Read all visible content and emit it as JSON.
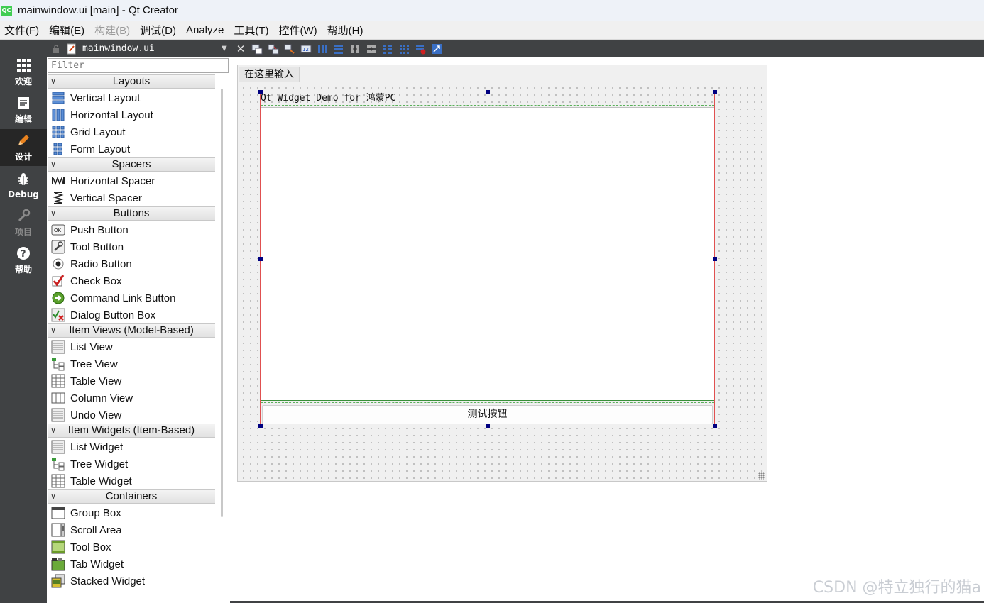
{
  "window": {
    "logo": "QC",
    "title": "mainwindow.ui [main] - Qt Creator"
  },
  "menubar": {
    "items": [
      {
        "label": "文件(F)",
        "enabled": true
      },
      {
        "label": "编辑(E)",
        "enabled": true
      },
      {
        "label": "构建(B)",
        "enabled": false
      },
      {
        "label": "调试(D)",
        "enabled": true
      },
      {
        "label": "Analyze",
        "enabled": true
      },
      {
        "label": "工具(T)",
        "enabled": true
      },
      {
        "label": "控件(W)",
        "enabled": true
      },
      {
        "label": "帮助(H)",
        "enabled": true
      }
    ]
  },
  "modes": [
    {
      "label": "欢迎",
      "icon": "grid-icon",
      "state": "normal"
    },
    {
      "label": "编辑",
      "icon": "document-icon",
      "state": "normal"
    },
    {
      "label": "设计",
      "icon": "pencil-icon",
      "state": "active"
    },
    {
      "label": "Debug",
      "icon": "bug-icon",
      "state": "normal"
    },
    {
      "label": "项目",
      "icon": "wrench-icon",
      "state": "disabled"
    },
    {
      "label": "帮助",
      "icon": "help-icon",
      "state": "normal"
    }
  ],
  "editor": {
    "filename": "mainwindow.ui",
    "close": "✕"
  },
  "widgetbox": {
    "filter_placeholder": "Filter",
    "categories": [
      {
        "name": "Layouts",
        "items": [
          {
            "label": "Vertical Layout",
            "icon": "vertical-layout-icon"
          },
          {
            "label": "Horizontal Layout",
            "icon": "horizontal-layout-icon"
          },
          {
            "label": "Grid Layout",
            "icon": "grid-layout-icon"
          },
          {
            "label": "Form Layout",
            "icon": "form-layout-icon"
          }
        ]
      },
      {
        "name": "Spacers",
        "items": [
          {
            "label": "Horizontal Spacer",
            "icon": "horizontal-spacer-icon"
          },
          {
            "label": "Vertical Spacer",
            "icon": "vertical-spacer-icon"
          }
        ]
      },
      {
        "name": "Buttons",
        "items": [
          {
            "label": "Push Button",
            "icon": "push-button-icon"
          },
          {
            "label": "Tool Button",
            "icon": "tool-button-icon"
          },
          {
            "label": "Radio Button",
            "icon": "radio-button-icon"
          },
          {
            "label": "Check Box",
            "icon": "check-box-icon"
          },
          {
            "label": "Command Link Button",
            "icon": "command-link-icon"
          },
          {
            "label": "Dialog Button Box",
            "icon": "dialog-button-box-icon"
          }
        ]
      },
      {
        "name": "Item Views (Model-Based)",
        "items": [
          {
            "label": "List View",
            "icon": "list-view-icon"
          },
          {
            "label": "Tree View",
            "icon": "tree-view-icon"
          },
          {
            "label": "Table View",
            "icon": "table-view-icon"
          },
          {
            "label": "Column View",
            "icon": "column-view-icon"
          },
          {
            "label": "Undo View",
            "icon": "undo-view-icon"
          }
        ]
      },
      {
        "name": "Item Widgets (Item-Based)",
        "items": [
          {
            "label": "List Widget",
            "icon": "list-widget-icon"
          },
          {
            "label": "Tree Widget",
            "icon": "tree-widget-icon"
          },
          {
            "label": "Table Widget",
            "icon": "table-widget-icon"
          }
        ]
      },
      {
        "name": "Containers",
        "items": [
          {
            "label": "Group Box",
            "icon": "group-box-icon"
          },
          {
            "label": "Scroll Area",
            "icon": "scroll-area-icon"
          },
          {
            "label": "Tool Box",
            "icon": "tool-box-icon"
          },
          {
            "label": "Tab Widget",
            "icon": "tab-widget-icon"
          },
          {
            "label": "Stacked Widget",
            "icon": "stacked-widget-icon"
          }
        ]
      }
    ]
  },
  "form": {
    "menu_placeholder": "在这里输入",
    "label_text": "Qt Widget Demo for 鸿蒙PC",
    "button_text": "测试按钮"
  },
  "watermark": "CSDN @特立独行的猫a",
  "colors": {
    "sidebar": "#404244",
    "active_mode": "#262626",
    "selection_handle": "#000080",
    "layout_border": "#e05050",
    "qt_green": "#41cd52"
  }
}
